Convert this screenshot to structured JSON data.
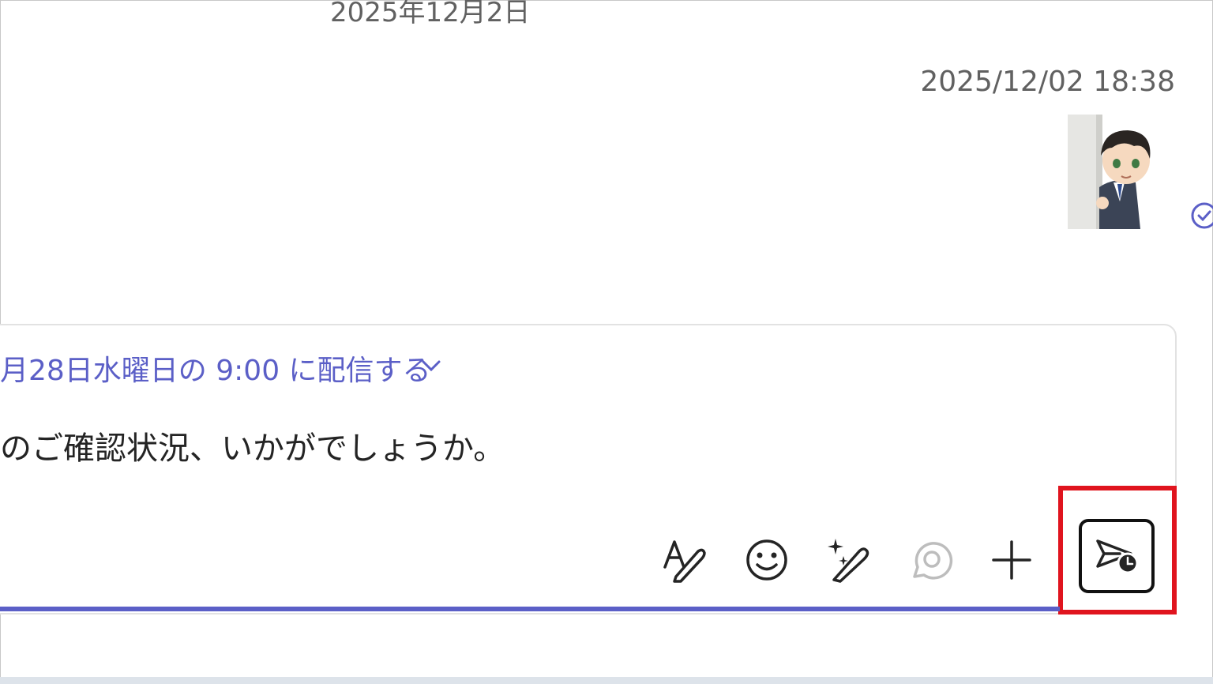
{
  "chat": {
    "date_divider": "2025年12月2日",
    "message_timestamp": "2025/12/02 18:38",
    "sticker_icon": "businessman-peeking-sticker",
    "read_receipt_icon": "check-circle-icon"
  },
  "compose": {
    "schedule_label": "月28日水曜日の 9:00 に配信する",
    "message_text": "のご確認状況、いかがでしょうか。",
    "accent_color": "#5b5fc7",
    "toolbar": [
      {
        "name": "format-icon",
        "interactable": true
      },
      {
        "name": "emoji-icon",
        "interactable": true
      },
      {
        "name": "copilot-rewrite-icon",
        "interactable": true
      },
      {
        "name": "loop-icon",
        "interactable": false
      },
      {
        "name": "plus-icon",
        "interactable": true
      },
      {
        "name": "schedule-send-icon",
        "interactable": true
      }
    ],
    "highlight_color": "#e0141e"
  }
}
